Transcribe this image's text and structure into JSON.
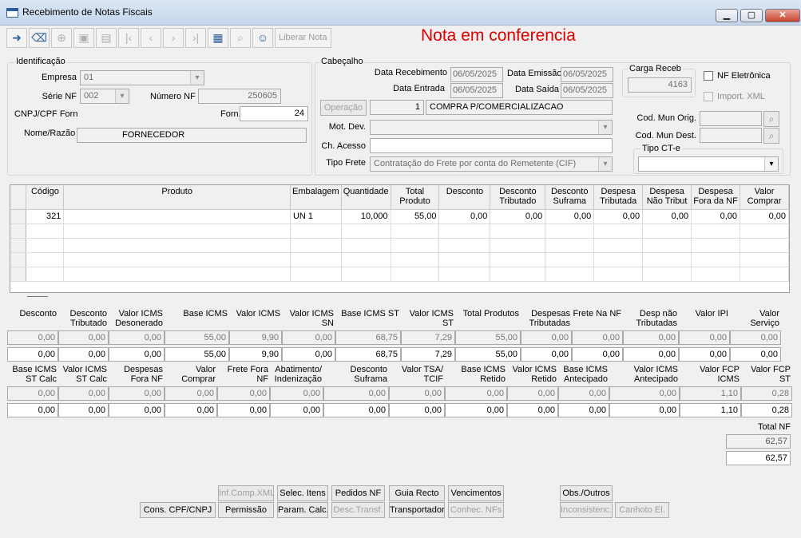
{
  "window": {
    "title": "Recebimento de Notas Fiscais",
    "min": "▁",
    "max": "▢",
    "close": "✕"
  },
  "toolbar": {
    "liberar_label": "Liberar Nota"
  },
  "status": "Nota em conferencia",
  "ident": {
    "group_label": "Identificação",
    "empresa_label": "Empresa",
    "empresa_value": "01",
    "serie_label": "Série NF",
    "serie_value": "002",
    "numero_label": "Número NF",
    "numero_value": "250605",
    "cnpj_label": "CNPJ/CPF Forn",
    "forn_label": "Forn.",
    "forn_value": "24",
    "nome_label": "Nome/Razão",
    "nome_value": "FORNECEDOR"
  },
  "cab": {
    "group_label": "Cabeçalho",
    "data_receb_label": "Data Recebimento",
    "data_receb": "06/05/2025",
    "data_emissao_label": "Data Emissão",
    "data_emissao": "06/05/2025",
    "data_entrada_label": "Data Entrada",
    "data_entrada": "06/05/2025",
    "data_saida_label": "Data Saída",
    "data_saida": "06/05/2025",
    "operacao_label": "Operação",
    "operacao_code": "1",
    "operacao_desc": "COMPRA P/COMERCIALIZACAO",
    "motdev_label": "Mot. Dev.",
    "chacesso_label": "Ch. Acesso",
    "tipofrete_label": "Tipo Frete",
    "tipofrete_value": "Contratação do Frete por conta do Remetente (CIF)"
  },
  "carga": {
    "label": "Carga Receb",
    "value": "4163"
  },
  "nfe": {
    "eletronica_label": "NF Eletrônica",
    "import_label": "Import. XML"
  },
  "mun": {
    "orig_label": "Cod. Mun Orig.",
    "dest_label": "Cod. Mun Dest."
  },
  "ctetipo": {
    "label": "Tipo CT-e"
  },
  "grid": {
    "columns": [
      "Código",
      "Produto",
      "Embalagem",
      "Quantidade",
      "Total Produto",
      "Desconto",
      "Desconto Tributado",
      "Desconto Suframa",
      "Despesa Tributada",
      "Despesa Não Tribut",
      "Despesa Fora da NF",
      "Valor Comprar"
    ],
    "rows": [
      [
        "321",
        "",
        "UN  1",
        "10,000",
        "55,00",
        "0,00",
        "0,00",
        "0,00",
        "0,00",
        "0,00",
        "0,00",
        "0,00"
      ]
    ]
  },
  "totals1": {
    "labels": [
      "Desconto",
      "Desconto Tributado",
      "Valor ICMS Desonerado",
      "Base ICMS",
      "Valor ICMS",
      "Valor ICMS SN",
      "Base ICMS ST",
      "Valor ICMS ST",
      "Total Produtos",
      "Despesas Tributadas",
      "Frete Na NF",
      "Desp não Tributadas",
      "Valor IPI",
      "Valor Serviço"
    ],
    "row_a": [
      "0,00",
      "0,00",
      "0,00",
      "55,00",
      "9,90",
      "0,00",
      "68,75",
      "7,29",
      "55,00",
      "0,00",
      "0,00",
      "0,00",
      "0,00",
      "0,00"
    ],
    "row_b": [
      "0,00",
      "0,00",
      "0,00",
      "55,00",
      "9,90",
      "0,00",
      "68,75",
      "7,29",
      "55,00",
      "0,00",
      "0,00",
      "0,00",
      "0,00",
      "0,00"
    ]
  },
  "totals2": {
    "labels": [
      "Base ICMS ST Calc",
      "Valor ICMS ST Calc",
      "Despesas Fora NF",
      "Valor Comprar",
      "Frete Fora NF",
      "Abatimento/ Indenização",
      "Desconto Suframa",
      "Valor TSA/ TCIF",
      "Base ICMS Retido",
      "Valor ICMS Retido",
      "Base ICMS Antecipado",
      "Valor ICMS Antecipado",
      "Valor FCP ICMS",
      "Valor FCP ST"
    ],
    "row_a": [
      "0,00",
      "0,00",
      "0,00",
      "0,00",
      "0,00",
      "0,00",
      "0,00",
      "0,00",
      "0,00",
      "0,00",
      "0,00",
      "0,00",
      "1,10",
      "0,28"
    ],
    "row_b": [
      "0,00",
      "0,00",
      "0,00",
      "0,00",
      "0,00",
      "0,00",
      "0,00",
      "0,00",
      "0,00",
      "0,00",
      "0,00",
      "0,00",
      "1,10",
      "0,28"
    ]
  },
  "totalnf": {
    "label": "Total NF",
    "value_a": "62,57",
    "value_b": "62,57"
  },
  "buttons": {
    "inf_comp_xml": "Inf.Comp.XML",
    "selec_itens": "Selec. Itens",
    "pedidos_nf": "Pedidos NF",
    "guia_recto": "Guia Recto",
    "vencimentos": "Vencimentos",
    "obs_outros": "Obs./Outros",
    "cons_cpf": "Cons. CPF/CNPJ",
    "permissao": "Permissão",
    "param_calc": "Param. Calc.",
    "desc_transf": "Desc.Transf.",
    "transportador": "Transportador",
    "conhec_nfs": "Conhec. NFs",
    "inconsistenc": "Inconsistenc.",
    "canhoto": "Canhoto El."
  }
}
